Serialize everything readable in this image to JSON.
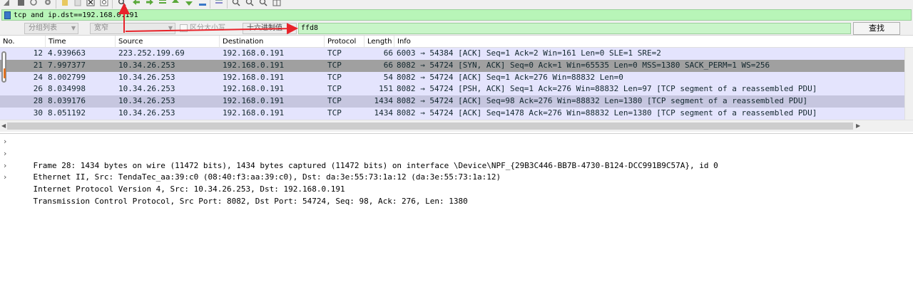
{
  "toolbar": {
    "icons": [
      "shark-fin-icon",
      "stop-capture-icon",
      "restart-capture-icon",
      "capture-options-icon",
      "open-file-icon",
      "save-file-icon",
      "close-file-icon",
      "reload-file-icon",
      "find-packet-icon",
      "go-back-icon",
      "go-forward-icon",
      "go-to-packet-icon",
      "go-first-icon",
      "go-last-icon",
      "auto-scroll-icon",
      "colorize-icon",
      "zoom-in-icon",
      "zoom-out-icon",
      "zoom-normal-icon",
      "resize-columns-icon"
    ]
  },
  "filter": {
    "value": "tcp and ip.dst==192.168.0.191"
  },
  "find_bar": {
    "search_in": "分组列表",
    "char_width": "宽窄",
    "case_sensitive_label": "区分大小写",
    "search_type": "十六进制值",
    "search_value": "ffd8",
    "find_button": "查找"
  },
  "columns": [
    "No.",
    "Time",
    "Source",
    "Destination",
    "Protocol",
    "Length",
    "Info"
  ],
  "packets": [
    {
      "no": "12",
      "time": "4.939663",
      "source": "223.252.199.69",
      "destination": "192.168.0.191",
      "protocol": "TCP",
      "length": "66",
      "info": "6003 → 54384 [ACK] Seq=1 Ack=2 Win=161 Len=0 SLE=1 SRE=2",
      "style": "ack"
    },
    {
      "no": "21",
      "time": "7.997377",
      "source": "10.34.26.253",
      "destination": "192.168.0.191",
      "protocol": "TCP",
      "length": "66",
      "info": "8082 → 54724 [SYN, ACK] Seq=0 Ack=1 Win=65535 Len=0 MSS=1380 SACK_PERM=1 WS=256",
      "style": "syn"
    },
    {
      "no": "24",
      "time": "8.002799",
      "source": "10.34.26.253",
      "destination": "192.168.0.191",
      "protocol": "TCP",
      "length": "54",
      "info": "8082 → 54724 [ACK] Seq=1 Ack=276 Win=88832 Len=0",
      "style": "ack"
    },
    {
      "no": "26",
      "time": "8.034998",
      "source": "10.34.26.253",
      "destination": "192.168.0.191",
      "protocol": "TCP",
      "length": "151",
      "info": "8082 → 54724 [PSH, ACK] Seq=1 Ack=276 Win=88832 Len=97 [TCP segment of a reassembled PDU]",
      "style": "ack"
    },
    {
      "no": "28",
      "time": "8.039176",
      "source": "10.34.26.253",
      "destination": "192.168.0.191",
      "protocol": "TCP",
      "length": "1434",
      "info": "8082 → 54724 [ACK] Seq=98 Ack=276 Win=88832 Len=1380 [TCP segment of a reassembled PDU]",
      "style": "sel"
    },
    {
      "no": "30",
      "time": "8.051192",
      "source": "10.34.26.253",
      "destination": "192.168.0.191",
      "protocol": "TCP",
      "length": "1434",
      "info": "8082 → 54724 [ACK] Seq=1478 Ack=276 Win=88832 Len=1380 [TCP segment of a reassembled PDU]",
      "style": "ack"
    }
  ],
  "details": [
    "Frame 28: 1434 bytes on wire (11472 bits), 1434 bytes captured (11472 bits) on interface \\Device\\NPF_{29B3C446-BB7B-4730-B124-DCC991B9C57A}, id 0",
    "Ethernet II, Src: TendaTec_aa:39:c0 (08:40:f3:aa:39:c0), Dst: da:3e:55:73:1a:12 (da:3e:55:73:1a:12)",
    "Internet Protocol Version 4, Src: 10.34.26.253, Dst: 192.168.0.191",
    "Transmission Control Protocol, Src Port: 8082, Dst Port: 54724, Seq: 98, Ack: 276, Len: 1380"
  ],
  "colors": {
    "filter_bg": "#b8f5b8",
    "row_ack": "#e4e4fd",
    "row_selected": "#c6c6df",
    "row_syn": "#a0a0a0",
    "annotation_arrow": "#e8232a"
  }
}
